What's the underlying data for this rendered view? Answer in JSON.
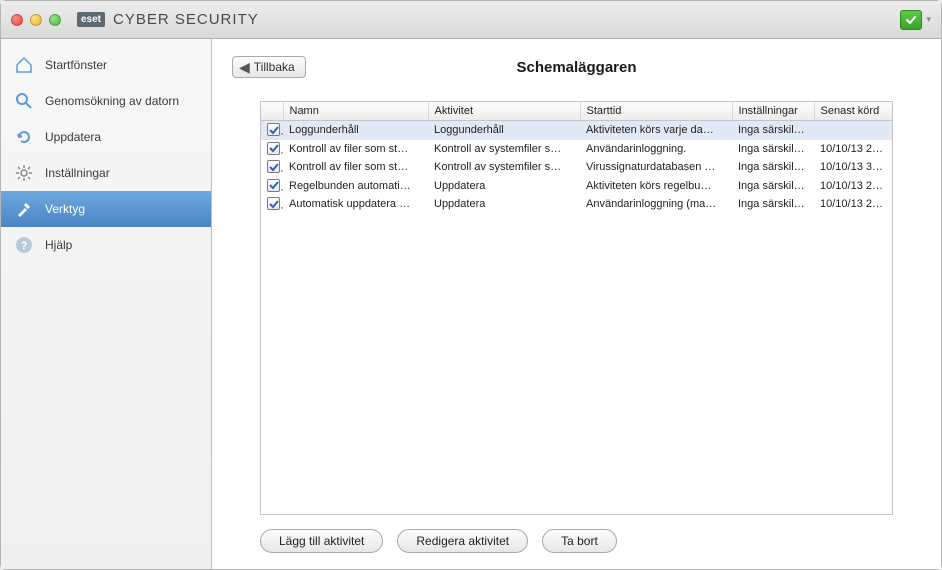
{
  "titlebar": {
    "brand_logo": "eset",
    "brand_text": "CYBER SECURITY"
  },
  "sidebar": {
    "items": [
      {
        "label": "Startfönster"
      },
      {
        "label": "Genomsökning av datorn"
      },
      {
        "label": "Uppdatera"
      },
      {
        "label": "Inställningar"
      },
      {
        "label": "Verktyg"
      },
      {
        "label": "Hjälp"
      }
    ]
  },
  "main": {
    "back_label": "Tillbaka",
    "page_title": "Schemaläggaren",
    "columns": {
      "name": "Namn",
      "activity": "Aktivitet",
      "start": "Starttid",
      "settings": "Inställningar",
      "last_run": "Senast körd"
    },
    "rows": [
      {
        "checked": true,
        "name": "Loggunderhåll",
        "activity": "Loggunderhåll",
        "start": "Aktiviteten körs varje da…",
        "settings": "Inga särskil…",
        "last_run": ""
      },
      {
        "checked": true,
        "name": "Kontroll av filer som st…",
        "activity": "Kontroll av systemfiler s…",
        "start": "Användarinloggning.",
        "settings": "Inga särskil…",
        "last_run": "10/10/13 2:…"
      },
      {
        "checked": true,
        "name": "Kontroll av filer som st…",
        "activity": "Kontroll av systemfiler s…",
        "start": "Virussignaturdatabasen …",
        "settings": "Inga särskil…",
        "last_run": "10/10/13 3:…"
      },
      {
        "checked": true,
        "name": "Regelbunden automati…",
        "activity": "Uppdatera",
        "start": "Aktiviteten körs regelbu…",
        "settings": "Inga särskil…",
        "last_run": "10/10/13 2:…"
      },
      {
        "checked": true,
        "name": "Automatisk uppdatera …",
        "activity": "Uppdatera",
        "start": "Användarinloggning (ma…",
        "settings": "Inga särskil…",
        "last_run": "10/10/13 2:…"
      }
    ],
    "buttons": {
      "add": "Lägg till aktivitet",
      "edit": "Redigera aktivitet",
      "delete": "Ta bort"
    }
  }
}
